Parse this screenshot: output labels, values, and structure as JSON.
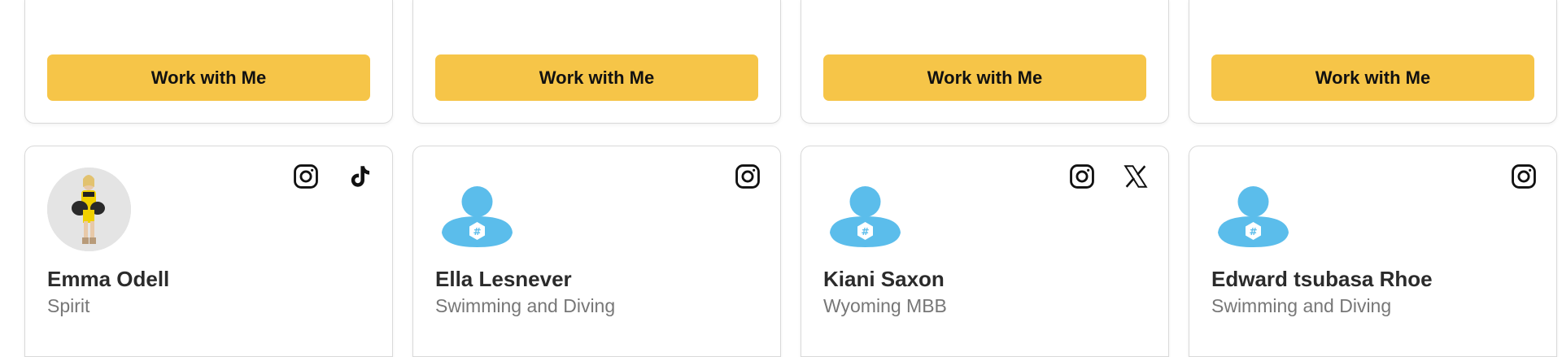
{
  "top_row": [
    {
      "button_label": "Work with Me"
    },
    {
      "button_label": "Work with Me"
    },
    {
      "button_label": "Work with Me"
    },
    {
      "button_label": "Work with Me"
    }
  ],
  "athletes": [
    {
      "name": "Emma Odell",
      "sport": "Spirit",
      "avatar": "photo",
      "socials": [
        "instagram-icon",
        "tiktok-icon"
      ]
    },
    {
      "name": "Ella Lesnever",
      "sport": "Swimming and Diving",
      "avatar": "default-avatar-icon",
      "socials": [
        "instagram-icon"
      ]
    },
    {
      "name": "Kiani Saxon",
      "sport": "Wyoming MBB",
      "avatar": "default-avatar-icon",
      "socials": [
        "instagram-icon",
        "x-icon"
      ]
    },
    {
      "name": "Edward tsubasa Rhoe",
      "sport": "Swimming and Diving",
      "avatar": "default-avatar-icon",
      "socials": [
        "instagram-icon"
      ]
    }
  ],
  "colors": {
    "button": "#f6c548",
    "avatar_blue": "#5bbdeb",
    "name_text": "#2b2b2b",
    "sport_text": "#777777",
    "card_border": "#d9d9d9"
  }
}
